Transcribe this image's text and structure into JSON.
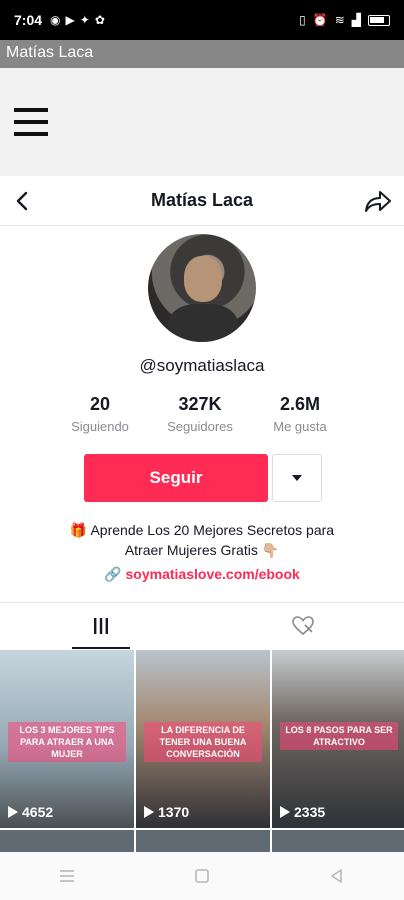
{
  "status_bar": {
    "time": "7:04",
    "icons_left": [
      "whatsapp-icon",
      "youtube-icon",
      "twitter-icon",
      "settings-icon"
    ],
    "icons_right": [
      "vibrate-icon",
      "alarm-icon",
      "wifi-icon",
      "signal-icon",
      "battery-icon"
    ]
  },
  "window": {
    "title": "Matías Laca"
  },
  "header": {
    "title": "Matías Laca",
    "back_icon": "chevron-left-icon",
    "share_icon": "share-icon"
  },
  "profile": {
    "username": "@soymatiaslaca",
    "stats": [
      {
        "value": "20",
        "label": "Siguiendo"
      },
      {
        "value": "327K",
        "label": "Seguidores"
      },
      {
        "value": "2.6M",
        "label": "Me gusta"
      }
    ],
    "follow_label": "Seguir",
    "bio_line1": "🎁 Aprende Los 20 Mejores Secretos para",
    "bio_line2": "Atraer Mujeres Gratis 👇🏼",
    "link": "soymatiaslove.com/ebook"
  },
  "tabs": [
    {
      "icon": "videos-grid-icon",
      "active": true
    },
    {
      "icon": "liked-heart-icon",
      "active": false
    }
  ],
  "videos": [
    {
      "views": "4652",
      "overlay": "LOS 3 MEJORES TIPS PARA ATRAER A UNA MUJER"
    },
    {
      "views": "1370",
      "overlay": "LA DIFERENCIA DE TENER UNA BUENA CONVERSACIÓN"
    },
    {
      "views": "2335",
      "overlay": "LOS 8 PASOS PARA SER ATRACTIVO"
    }
  ],
  "colors": {
    "accent": "#fe2c55",
    "text": "#161823",
    "muted": "#8a8b91"
  }
}
